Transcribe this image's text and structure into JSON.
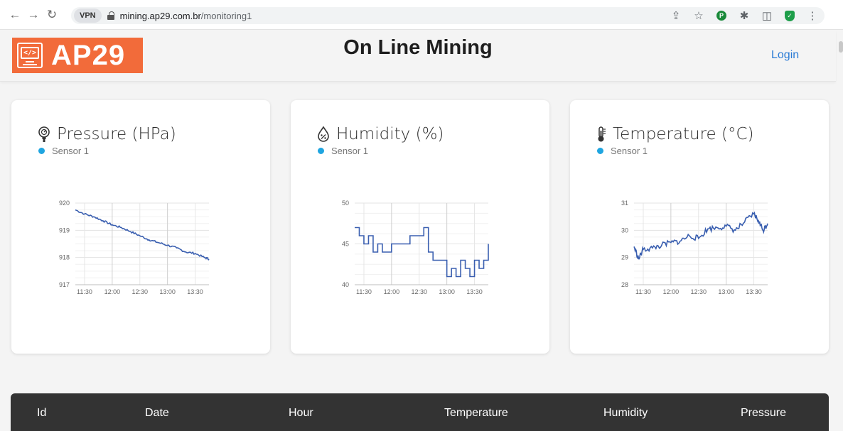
{
  "browser": {
    "back_icon": "arrow-left-icon",
    "forward_icon": "arrow-right-icon",
    "reload_icon": "reload-icon",
    "vpn_label": "VPN",
    "url_host": "mining.ap29.com.br",
    "url_path": "/monitoring1"
  },
  "header": {
    "logo_text": "AP29",
    "title": "On Line Mining",
    "login": "Login"
  },
  "cards": [
    {
      "title": "Pressure (HPa)",
      "icon": "gauge-icon",
      "legend": "Sensor 1",
      "chart_data": {
        "type": "line",
        "x": [
          "11:20",
          "11:30",
          "11:40",
          "11:50",
          "12:00",
          "12:10",
          "12:20",
          "12:30",
          "12:40",
          "12:50",
          "13:00",
          "13:10",
          "13:20",
          "13:30",
          "13:40",
          "13:45"
        ],
        "series": [
          {
            "values": [
              919.75,
              919.6,
              919.5,
              919.35,
              919.2,
              919.1,
              918.95,
              918.8,
              918.65,
              918.55,
              918.45,
              918.35,
              918.2,
              918.15,
              918.0,
              917.95
            ]
          }
        ],
        "ylim": [
          917,
          920
        ],
        "yticks": [
          "920",
          "919",
          "918",
          "917"
        ],
        "xticks": [
          "11:30",
          "12:00",
          "12:30",
          "13:00",
          "13:30"
        ]
      }
    },
    {
      "title": "Humidity (%)",
      "icon": "droplet-icon",
      "legend": "Sensor 1",
      "chart_data": {
        "type": "line",
        "x": [
          "11:20",
          "11:25",
          "11:30",
          "11:35",
          "11:40",
          "11:45",
          "11:50",
          "12:00",
          "12:10",
          "12:20",
          "12:30",
          "12:35",
          "12:40",
          "12:45",
          "12:50",
          "13:00",
          "13:05",
          "13:10",
          "13:15",
          "13:20",
          "13:25",
          "13:30",
          "13:35",
          "13:40",
          "13:45"
        ],
        "series": [
          {
            "values": [
              47,
              46,
              45,
              46,
              44,
              45,
              44,
              45,
              45,
              46,
              46,
              47,
              44,
              43,
              43,
              41,
              42,
              41,
              43,
              42,
              41,
              43,
              42,
              43,
              45
            ]
          }
        ],
        "ylim": [
          40,
          50
        ],
        "yticks": [
          "50",
          "45",
          "40"
        ],
        "xticks": [
          "11:30",
          "12:00",
          "12:30",
          "13:00",
          "13:30"
        ]
      }
    },
    {
      "title": "Temperature (°C)",
      "icon": "thermometer-icon",
      "legend": "Sensor 1",
      "chart_data": {
        "type": "line",
        "x": [
          "11:20",
          "11:25",
          "11:30",
          "11:40",
          "11:50",
          "12:00",
          "12:10",
          "12:20",
          "12:30",
          "12:40",
          "12:50",
          "13:00",
          "13:10",
          "13:20",
          "13:30",
          "13:35",
          "13:40",
          "13:45"
        ],
        "series": [
          {
            "values": [
              29.4,
              28.95,
              29.3,
              29.35,
              29.45,
              29.55,
              29.6,
              29.8,
              29.7,
              30.05,
              30.1,
              30.15,
              30.0,
              30.3,
              30.6,
              30.35,
              30.0,
              30.25
            ]
          }
        ],
        "ylim": [
          28,
          31
        ],
        "yticks": [
          "31",
          "30",
          "29",
          "28"
        ],
        "xticks": [
          "11:30",
          "12:00",
          "12:30",
          "13:00",
          "13:30"
        ]
      }
    }
  ],
  "table": {
    "headers": [
      "Id",
      "Date",
      "Hour",
      "Temperature",
      "Humidity",
      "Pressure"
    ]
  },
  "colors": {
    "brand": "#f26b3a",
    "series": "#3a5fb0",
    "legend_dot": "#1fa5e0",
    "table_header": "#333333",
    "login": "#2a7bd5"
  }
}
